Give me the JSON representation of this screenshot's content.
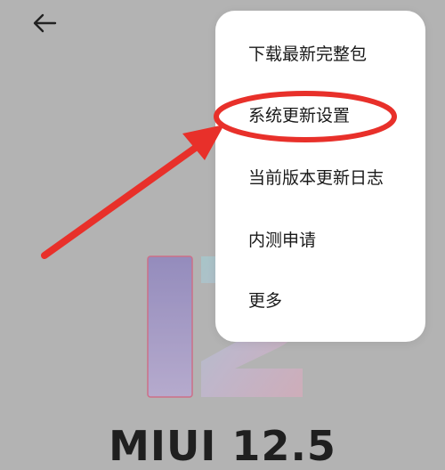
{
  "header": {
    "back_icon": "back-arrow-icon"
  },
  "menu": {
    "items": [
      {
        "label": "下载最新完整包"
      },
      {
        "label": "系统更新设置"
      },
      {
        "label": "当前版本更新日志"
      },
      {
        "label": "内测申请"
      },
      {
        "label": "更多"
      }
    ],
    "highlighted_item_index": 1
  },
  "brand": {
    "name": "MIUI 12.5"
  },
  "annotation": {
    "type": "arrow-and-ellipse",
    "color": "#e8302a"
  }
}
